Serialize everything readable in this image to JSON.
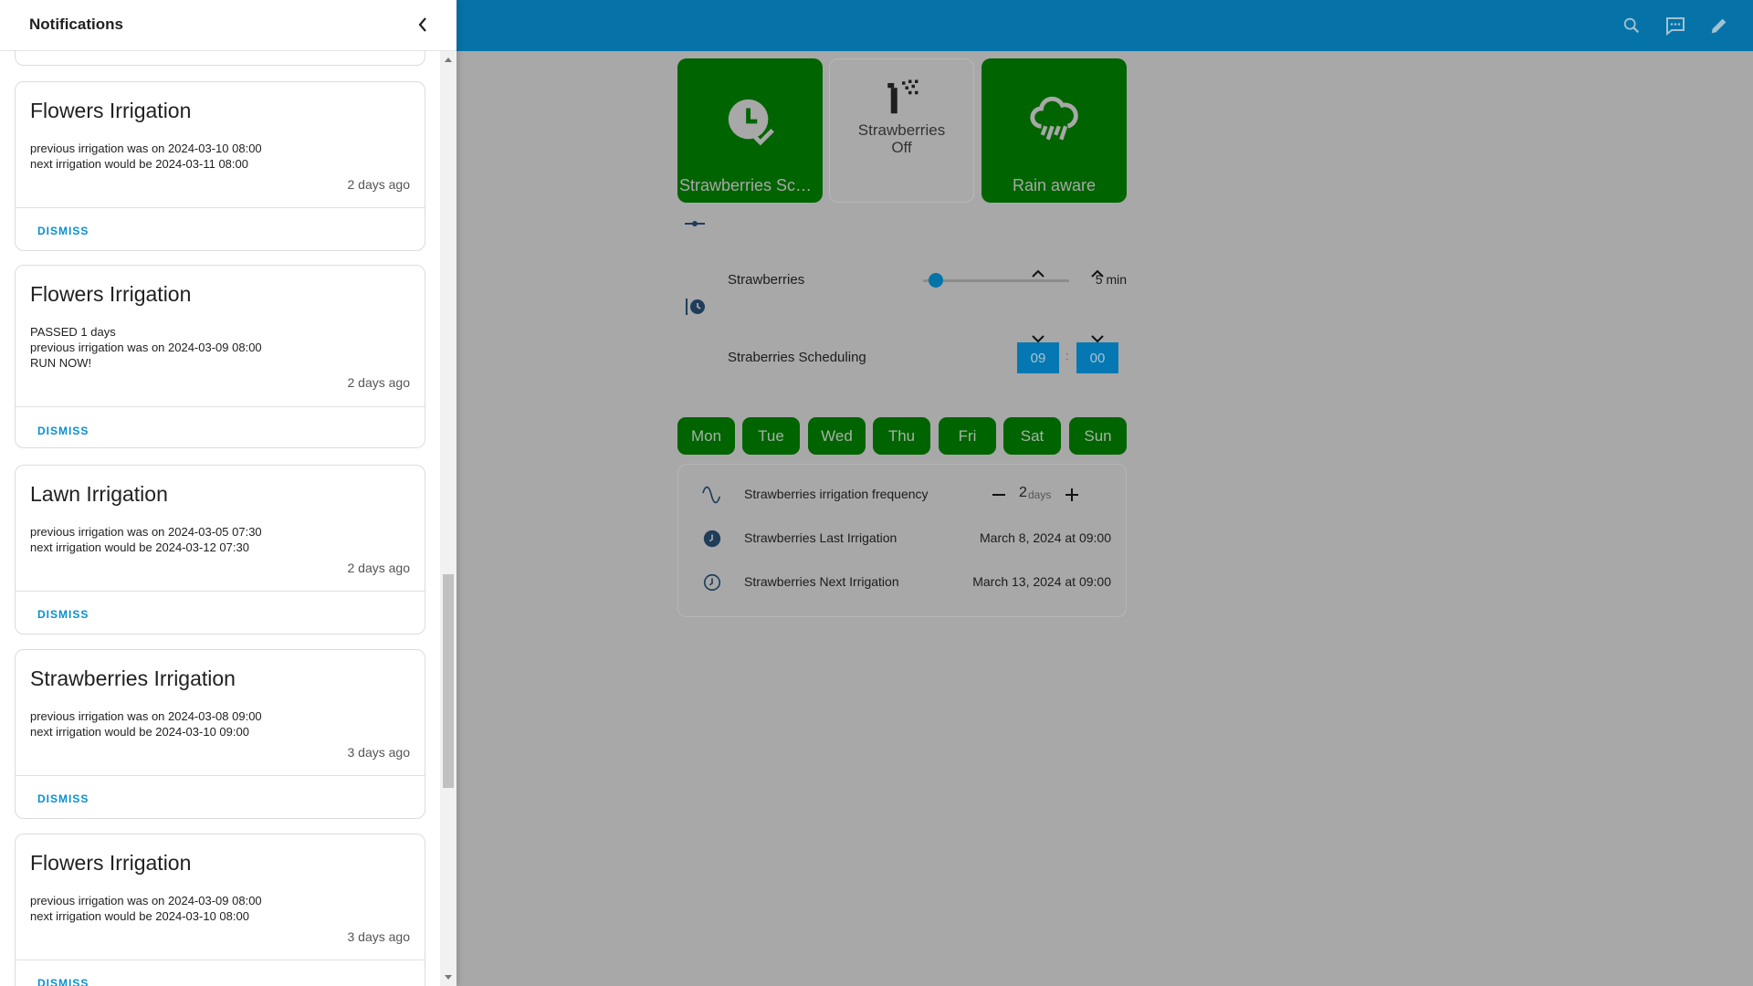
{
  "drawer": {
    "title": "Notifications",
    "notifications": [
      {
        "title": "Flowers Irrigation",
        "body": "previous irrigation was on 2024-03-10 08:00\nnext irrigation would be 2024-03-11 08:00",
        "time": "2 days ago",
        "dismiss": "DISMISS"
      },
      {
        "title": "Flowers Irrigation",
        "body": "PASSED 1 days\nprevious irrigation was on 2024-03-09 08:00\nRUN NOW!",
        "time": "2 days ago",
        "dismiss": "DISMISS"
      },
      {
        "title": "Lawn Irrigation",
        "body": "previous irrigation was on 2024-03-05 07:30\nnext irrigation would be 2024-03-12 07:30",
        "time": "2 days ago",
        "dismiss": "DISMISS"
      },
      {
        "title": "Strawberries Irrigation",
        "body": "previous irrigation was on 2024-03-08 09:00\nnext irrigation would be 2024-03-10 09:00",
        "time": "3 days ago",
        "dismiss": "DISMISS"
      },
      {
        "title": "Flowers Irrigation",
        "body": "previous irrigation was on 2024-03-09 08:00\nnext irrigation would be 2024-03-10 08:00",
        "time": "3 days ago",
        "dismiss": "DISMISS"
      }
    ],
    "scroll_position": 0.56
  },
  "topbar": {
    "icons": [
      "search-icon",
      "chat-icon",
      "pencil-icon"
    ],
    "color": "#0573a8"
  },
  "tiles": [
    {
      "label": "Strawberries Sched...",
      "icon": "clock-check-icon",
      "state": "on"
    },
    {
      "label": "Strawberries",
      "sublabel": "Off",
      "icon": "sprinkler-icon",
      "state": "off"
    },
    {
      "label": "Rain aware",
      "icon": "weather-rain-icon",
      "state": "on"
    }
  ],
  "duration": {
    "name": "Strawberries",
    "value": "5 min",
    "level": 0.05
  },
  "scheduling": {
    "name": "Straberries Scheduling",
    "hour": "09",
    "separator": ":",
    "minute": "00"
  },
  "days": [
    "Mon",
    "Tue",
    "Wed",
    "Thu",
    "Fri",
    "Sat",
    "Sun"
  ],
  "info": {
    "frequency": {
      "name": "Strawberries irrigation frequency",
      "value": "2",
      "unit": "days"
    },
    "last": {
      "name": "Strawberries Last Irrigation",
      "value": "March 8, 2024 at 09:00"
    },
    "next": {
      "name": "Strawberries Next Irrigation",
      "value": "March 13, 2024 at 09:00"
    }
  },
  "colors": {
    "accent": "#0573a8",
    "tile_on": "#006400",
    "dismiss": "#0a8ed1"
  }
}
